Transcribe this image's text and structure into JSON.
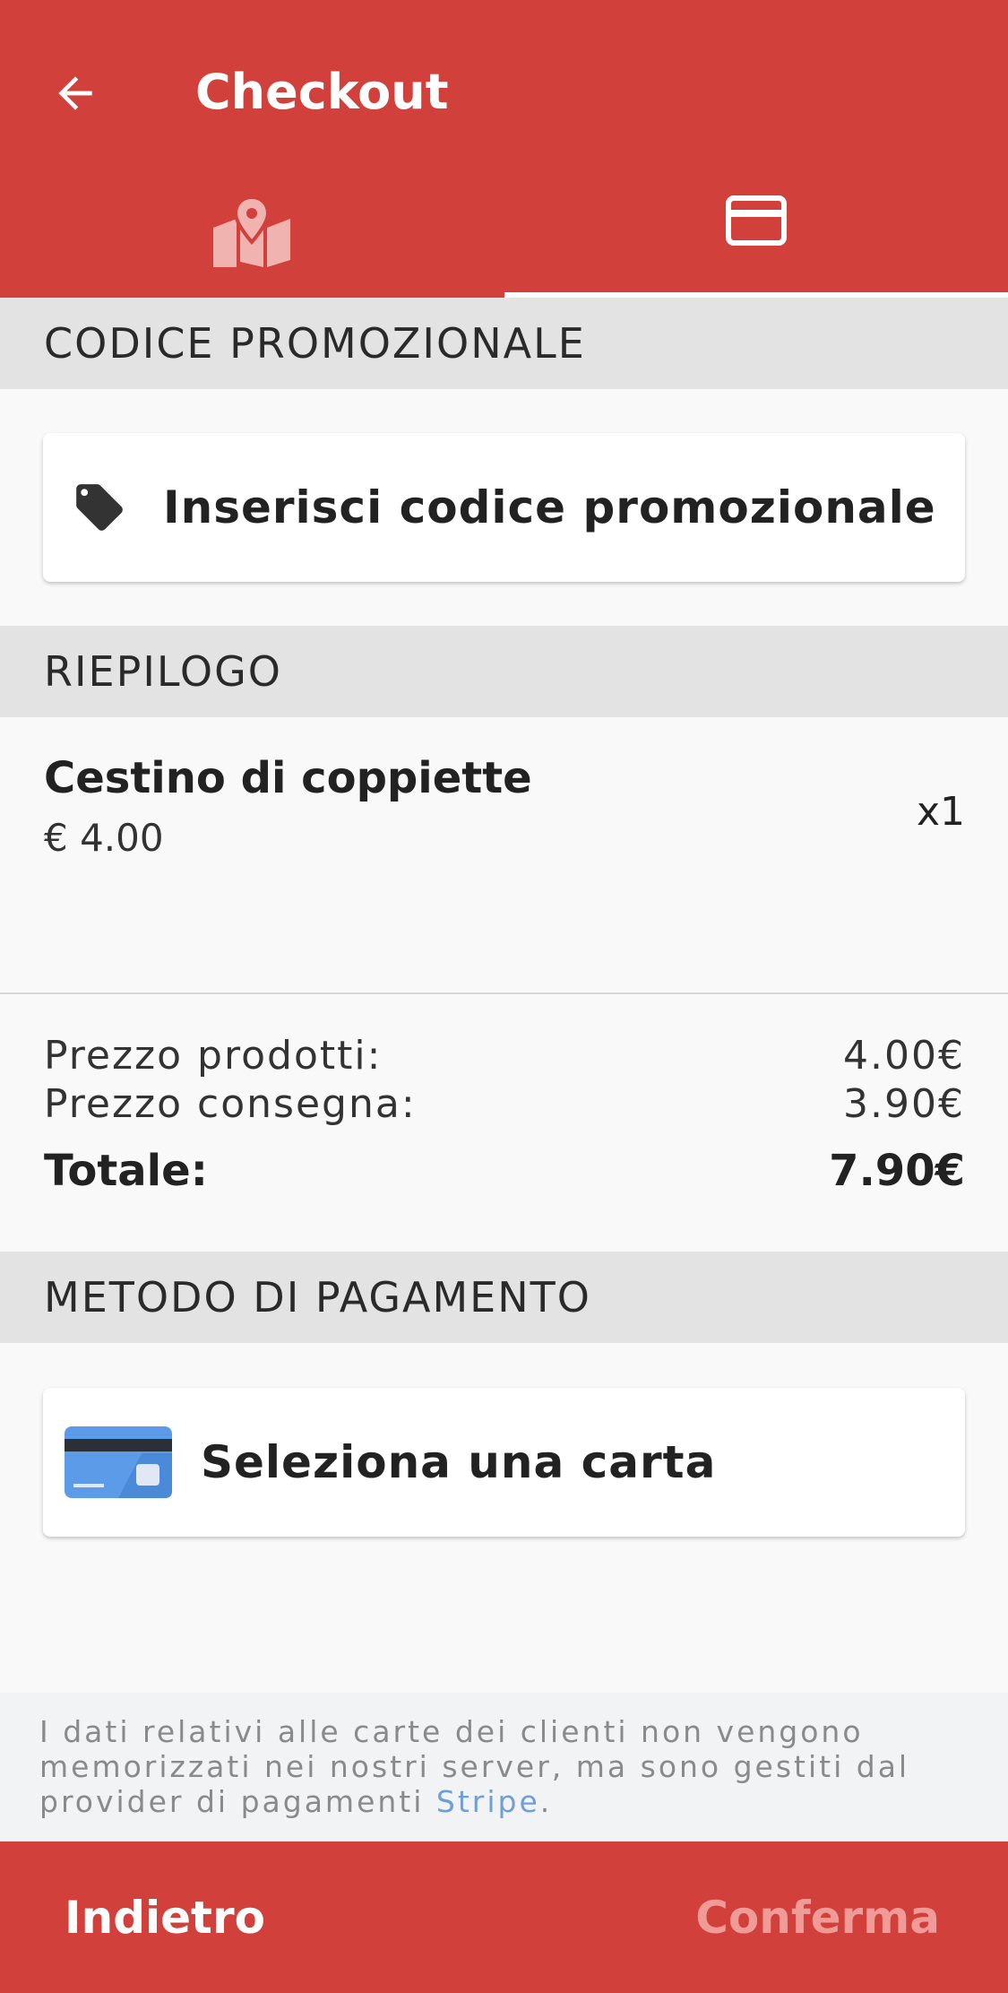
{
  "header": {
    "title": "Checkout",
    "back_icon": "arrow-left-icon",
    "tabs": [
      {
        "icon": "map-marker-icon",
        "selected": false
      },
      {
        "icon": "credit-card-icon",
        "selected": true
      }
    ]
  },
  "promo": {
    "section_title": "CODICE PROMOZIONALE",
    "button_label": "Inserisci codice promozionale",
    "icon": "tag-icon"
  },
  "summary": {
    "section_title": "RIEPILOGO",
    "items": [
      {
        "name": "Cestino di coppiette",
        "price": "€ 4.00",
        "qty": "x1"
      }
    ],
    "products_label": "Prezzo prodotti:",
    "products_value": "4.00€",
    "delivery_label": "Prezzo consegna:",
    "delivery_value": "3.90€",
    "total_label": "Totale:",
    "total_value": "7.90€"
  },
  "payment": {
    "section_title": "METODO DI PAGAMENTO",
    "button_label": "Seleziona una carta",
    "icon": "credit-card-icon"
  },
  "note": {
    "text": "I dati relativi alle carte dei clienti non vengono memorizzati nei nostri server, ma sono gestiti dal provider di pagamenti ",
    "link": "Stripe",
    "suffix": "."
  },
  "footer": {
    "back_label": "Indietro",
    "confirm_label": "Conferma"
  },
  "colors": {
    "primary": "#d1403a",
    "section_bg": "#e3e3e3",
    "confirm_disabled": "#f19b98",
    "link": "#6f9fd8"
  }
}
